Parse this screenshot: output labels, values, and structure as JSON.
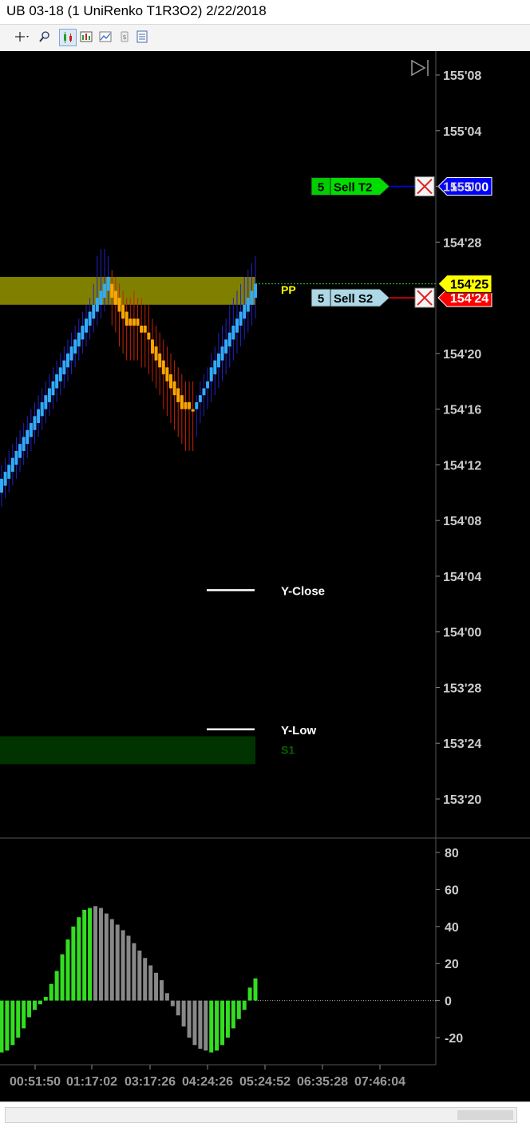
{
  "window": {
    "title": "UB 03-18 (1 UniRenko T1R3O2)  2/22/2018"
  },
  "toolbar": {
    "icons": [
      "crosshair-icon",
      "zoom-icon",
      "bar-style-icon",
      "data-box-icon",
      "indicators-icon",
      "strategies-icon",
      "properties-icon"
    ]
  },
  "colors": {
    "background": "#000000",
    "up_bar": "#33aaff",
    "down_bar": "#ffa500",
    "pp_zone": "#808000",
    "s1_zone": "#003300",
    "hist_up": "#33dd22",
    "hist_neutral": "#888888",
    "axis_text": "#cccccc"
  },
  "chart_data": [
    {
      "type": "candlestick",
      "title": "",
      "price_axis_labels": [
        "155'08",
        "155'04",
        "155'00",
        "154'28",
        "154'25",
        "154'24",
        "154'20",
        "154'16",
        "154'12",
        "154'08",
        "154'04",
        "154'00",
        "153'28",
        "153'24",
        "153'20"
      ],
      "ylim": [
        153.5,
        155.375
      ],
      "ticks": [
        155.25,
        155.125,
        155.0,
        154.875,
        154.75,
        154.625,
        154.5,
        154.375,
        154.25,
        154.125,
        154.0,
        153.875,
        153.75,
        153.625
      ],
      "tick_labels": [
        "155'08",
        "155'04",
        "155'00",
        "154'28",
        "154'20",
        "154'16",
        "154'12",
        "154'08",
        "154'04",
        "154'00",
        "153'28",
        "153'24",
        "153'20"
      ],
      "tick_values": [
        155.25,
        155.125,
        155.0,
        154.875,
        154.625,
        154.5,
        154.375,
        154.25,
        154.125,
        154.0,
        153.875,
        153.75,
        153.625
      ],
      "bars": [
        {
          "o": 154.3125,
          "c": 154.34375,
          "h": 154.375,
          "l": 154.28125,
          "d": "up"
        },
        {
          "o": 154.328125,
          "c": 154.359375,
          "h": 154.390625,
          "l": 154.3,
          "d": "up"
        },
        {
          "o": 154.34375,
          "c": 154.375,
          "h": 154.40625,
          "l": 154.3125,
          "d": "up"
        },
        {
          "o": 154.359375,
          "c": 154.390625,
          "h": 154.421875,
          "l": 154.328125,
          "d": "up"
        },
        {
          "o": 154.375,
          "c": 154.40625,
          "h": 154.4375,
          "l": 154.34375,
          "d": "up"
        },
        {
          "o": 154.390625,
          "c": 154.421875,
          "h": 154.453125,
          "l": 154.359375,
          "d": "up"
        },
        {
          "o": 154.40625,
          "c": 154.4375,
          "h": 154.46875,
          "l": 154.375,
          "d": "up"
        },
        {
          "o": 154.421875,
          "c": 154.453125,
          "h": 154.484375,
          "l": 154.390625,
          "d": "up"
        },
        {
          "o": 154.4375,
          "c": 154.46875,
          "h": 154.5,
          "l": 154.40625,
          "d": "up"
        },
        {
          "o": 154.453125,
          "c": 154.484375,
          "h": 154.515625,
          "l": 154.421875,
          "d": "up"
        },
        {
          "o": 154.46875,
          "c": 154.5,
          "h": 154.53125,
          "l": 154.4375,
          "d": "up"
        },
        {
          "o": 154.484375,
          "c": 154.515625,
          "h": 154.546875,
          "l": 154.453125,
          "d": "up"
        },
        {
          "o": 154.5,
          "c": 154.53125,
          "h": 154.5625,
          "l": 154.46875,
          "d": "up"
        },
        {
          "o": 154.515625,
          "c": 154.546875,
          "h": 154.578125,
          "l": 154.484375,
          "d": "up"
        },
        {
          "o": 154.53125,
          "c": 154.5625,
          "h": 154.59375,
          "l": 154.5,
          "d": "up"
        },
        {
          "o": 154.546875,
          "c": 154.578125,
          "h": 154.609375,
          "l": 154.515625,
          "d": "up"
        },
        {
          "o": 154.5625,
          "c": 154.59375,
          "h": 154.625,
          "l": 154.53125,
          "d": "up"
        },
        {
          "o": 154.578125,
          "c": 154.609375,
          "h": 154.640625,
          "l": 154.546875,
          "d": "up"
        },
        {
          "o": 154.59375,
          "c": 154.625,
          "h": 154.65625,
          "l": 154.5625,
          "d": "up"
        },
        {
          "o": 154.609375,
          "c": 154.640625,
          "h": 154.671875,
          "l": 154.578125,
          "d": "up"
        },
        {
          "o": 154.625,
          "c": 154.65625,
          "h": 154.6875,
          "l": 154.59375,
          "d": "up"
        },
        {
          "o": 154.640625,
          "c": 154.671875,
          "h": 154.703125,
          "l": 154.609375,
          "d": "up"
        },
        {
          "o": 154.65625,
          "c": 154.6875,
          "h": 154.71875,
          "l": 154.625,
          "d": "up"
        },
        {
          "o": 154.671875,
          "c": 154.703125,
          "h": 154.734375,
          "l": 154.640625,
          "d": "up"
        },
        {
          "o": 154.6875,
          "c": 154.71875,
          "h": 154.75,
          "l": 154.65625,
          "d": "up"
        },
        {
          "o": 154.703125,
          "c": 154.734375,
          "h": 154.78125,
          "l": 154.671875,
          "d": "up"
        },
        {
          "o": 154.71875,
          "c": 154.75,
          "h": 154.84375,
          "l": 154.6875,
          "d": "up"
        },
        {
          "o": 154.734375,
          "c": 154.765625,
          "h": 154.859375,
          "l": 154.703125,
          "d": "up"
        },
        {
          "o": 154.75,
          "c": 154.78125,
          "h": 154.859375,
          "l": 154.71875,
          "d": "up"
        },
        {
          "o": 154.765625,
          "c": 154.796875,
          "h": 154.84375,
          "l": 154.734375,
          "d": "up"
        },
        {
          "o": 154.78125,
          "c": 154.75,
          "h": 154.8125,
          "l": 154.6875,
          "d": "down"
        },
        {
          "o": 154.765625,
          "c": 154.734375,
          "h": 154.796875,
          "l": 154.671875,
          "d": "down"
        },
        {
          "o": 154.75,
          "c": 154.71875,
          "h": 154.78125,
          "l": 154.640625,
          "d": "down"
        },
        {
          "o": 154.734375,
          "c": 154.703125,
          "h": 154.765625,
          "l": 154.625,
          "d": "down"
        },
        {
          "o": 154.71875,
          "c": 154.6875,
          "h": 154.75,
          "l": 154.609375,
          "d": "down"
        },
        {
          "o": 154.703125,
          "c": 154.6875,
          "h": 154.75,
          "l": 154.609375,
          "d": "down"
        },
        {
          "o": 154.703125,
          "c": 154.6875,
          "h": 154.765625,
          "l": 154.609375,
          "d": "down"
        },
        {
          "o": 154.703125,
          "c": 154.6875,
          "h": 154.75,
          "l": 154.609375,
          "d": "down"
        },
        {
          "o": 154.6875,
          "c": 154.671875,
          "h": 154.75,
          "l": 154.59375,
          "d": "down"
        },
        {
          "o": 154.6875,
          "c": 154.671875,
          "h": 154.734375,
          "l": 154.59375,
          "d": "down"
        },
        {
          "o": 154.671875,
          "c": 154.65625,
          "h": 154.734375,
          "l": 154.578125,
          "d": "down"
        },
        {
          "o": 154.65625,
          "c": 154.625,
          "h": 154.703125,
          "l": 154.5625,
          "d": "down"
        },
        {
          "o": 154.640625,
          "c": 154.609375,
          "h": 154.6875,
          "l": 154.546875,
          "d": "down"
        },
        {
          "o": 154.625,
          "c": 154.59375,
          "h": 154.671875,
          "l": 154.53125,
          "d": "down"
        },
        {
          "o": 154.609375,
          "c": 154.578125,
          "h": 154.65625,
          "l": 154.5,
          "d": "down"
        },
        {
          "o": 154.59375,
          "c": 154.5625,
          "h": 154.640625,
          "l": 154.484375,
          "d": "down"
        },
        {
          "o": 154.578125,
          "c": 154.546875,
          "h": 154.625,
          "l": 154.46875,
          "d": "down"
        },
        {
          "o": 154.5625,
          "c": 154.53125,
          "h": 154.609375,
          "l": 154.453125,
          "d": "down"
        },
        {
          "o": 154.546875,
          "c": 154.515625,
          "h": 154.59375,
          "l": 154.4375,
          "d": "down"
        },
        {
          "o": 154.53125,
          "c": 154.5,
          "h": 154.578125,
          "l": 154.421875,
          "d": "down"
        },
        {
          "o": 154.515625,
          "c": 154.5,
          "h": 154.5625,
          "l": 154.40625,
          "d": "down"
        },
        {
          "o": 154.515625,
          "c": 154.5,
          "h": 154.5625,
          "l": 154.40625,
          "d": "down"
        },
        {
          "o": 154.5,
          "c": 154.5,
          "h": 154.5625,
          "l": 154.40625,
          "d": "down"
        },
        {
          "o": 154.5,
          "c": 154.515625,
          "h": 154.53125,
          "l": 154.4375,
          "d": "up"
        },
        {
          "o": 154.515625,
          "c": 154.53125,
          "h": 154.5625,
          "l": 154.46875,
          "d": "up"
        },
        {
          "o": 154.53125,
          "c": 154.546875,
          "h": 154.578125,
          "l": 154.484375,
          "d": "up"
        },
        {
          "o": 154.546875,
          "c": 154.5625,
          "h": 154.59375,
          "l": 154.5,
          "d": "up"
        },
        {
          "o": 154.5625,
          "c": 154.59375,
          "h": 154.625,
          "l": 154.515625,
          "d": "up"
        },
        {
          "o": 154.578125,
          "c": 154.609375,
          "h": 154.640625,
          "l": 154.53125,
          "d": "up"
        },
        {
          "o": 154.59375,
          "c": 154.625,
          "h": 154.671875,
          "l": 154.546875,
          "d": "up"
        },
        {
          "o": 154.609375,
          "c": 154.640625,
          "h": 154.6875,
          "l": 154.5625,
          "d": "up"
        },
        {
          "o": 154.625,
          "c": 154.65625,
          "h": 154.703125,
          "l": 154.578125,
          "d": "up"
        },
        {
          "o": 154.640625,
          "c": 154.671875,
          "h": 154.734375,
          "l": 154.59375,
          "d": "up"
        },
        {
          "o": 154.65625,
          "c": 154.6875,
          "h": 154.75,
          "l": 154.609375,
          "d": "up"
        },
        {
          "o": 154.671875,
          "c": 154.703125,
          "h": 154.765625,
          "l": 154.625,
          "d": "up"
        },
        {
          "o": 154.6875,
          "c": 154.71875,
          "h": 154.78125,
          "l": 154.640625,
          "d": "up"
        },
        {
          "o": 154.703125,
          "c": 154.734375,
          "h": 154.796875,
          "l": 154.65625,
          "d": "up"
        },
        {
          "o": 154.71875,
          "c": 154.75,
          "h": 154.8125,
          "l": 154.671875,
          "d": "up"
        },
        {
          "o": 154.734375,
          "c": 154.765625,
          "h": 154.828125,
          "l": 154.6875,
          "d": "up"
        },
        {
          "o": 154.75,
          "c": 154.78125,
          "h": 154.84375,
          "l": 154.703125,
          "d": "up"
        }
      ],
      "zones": [
        {
          "label": "PP",
          "from": 154.734375,
          "to": 154.796875,
          "color": "#808000",
          "label_color": "#ffff00"
        },
        {
          "label": "S1",
          "from": 153.703125,
          "to": 153.765625,
          "color": "#003300",
          "label_color": "#006600"
        }
      ],
      "levels": [
        {
          "label": "Y-Close",
          "value": 154.09375
        },
        {
          "label": "Y-Low",
          "value": 153.78125
        }
      ],
      "orders": [
        {
          "qty": "5",
          "name": "Sell T2",
          "price": 155.0,
          "price_label": "155'00",
          "qty_bg": "#00cc00",
          "name_bg": "#00dd00",
          "line_color": "#0000ff",
          "tag_color": "#0000ff",
          "tag_text": "#ffffff"
        },
        {
          "qty": "5",
          "name": "Sell S2",
          "price": 154.75,
          "price_label": "154'24",
          "qty_bg": "#add8e6",
          "name_bg": "#add8e6",
          "line_color": "#ff0000",
          "tag_color": "#ff0000",
          "tag_text": "#ffffff"
        }
      ],
      "last_price": {
        "value": 154.78125,
        "label": "154'25",
        "color": "#ffff00"
      }
    },
    {
      "type": "bar",
      "title": "",
      "ylim": [
        -30,
        90
      ],
      "tick_values": [
        80,
        60,
        40,
        20,
        0,
        -20
      ],
      "tick_labels": [
        "80",
        "60",
        "40",
        "20",
        "0",
        "-20"
      ],
      "values": [
        -28,
        -27,
        -24,
        -20,
        -15,
        -9,
        -5,
        -2,
        2,
        9,
        16,
        25,
        33,
        40,
        45,
        49,
        50,
        51,
        50,
        47,
        44,
        41,
        38,
        35,
        31,
        27,
        23,
        19,
        15,
        11,
        4,
        -3,
        -8,
        -14,
        -20,
        -24,
        -26,
        -27,
        -28,
        -27,
        -24,
        -20,
        -15,
        -10,
        -5,
        7,
        12
      ],
      "colors": [
        "up",
        "up",
        "up",
        "up",
        "up",
        "up",
        "up",
        "up",
        "up",
        "up",
        "up",
        "up",
        "up",
        "up",
        "up",
        "up",
        "up",
        "neutral",
        "neutral",
        "neutral",
        "neutral",
        "neutral",
        "neutral",
        "neutral",
        "neutral",
        "neutral",
        "neutral",
        "neutral",
        "neutral",
        "neutral",
        "neutral",
        "neutral",
        "neutral",
        "neutral",
        "neutral",
        "neutral",
        "neutral",
        "neutral",
        "up",
        "up",
        "up",
        "up",
        "up",
        "up",
        "up",
        "up",
        "up"
      ]
    }
  ],
  "time_axis": {
    "labels": [
      "00:51:50",
      "01:17:02",
      "03:17:26",
      "04:24:26",
      "05:24:52",
      "06:35:28",
      "07:46:04"
    ]
  }
}
